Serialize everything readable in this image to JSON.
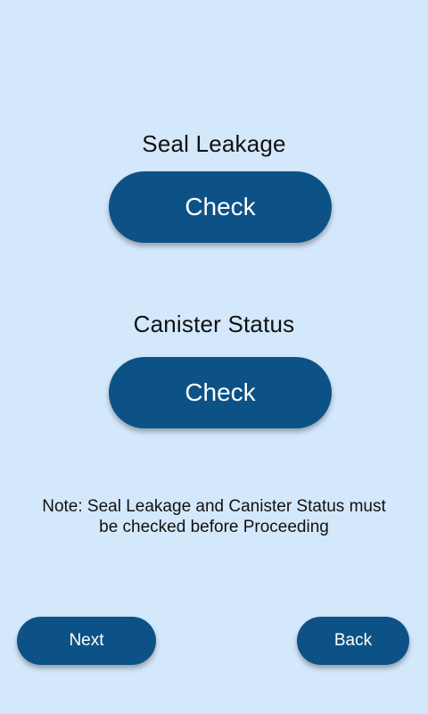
{
  "seal_leakage": {
    "title": "Seal Leakage",
    "button_label": "Check"
  },
  "canister_status": {
    "title": "Canister Status",
    "button_label": "Check"
  },
  "note": {
    "line1": "Note: Seal Leakage and Canister Status must",
    "line2": "be checked before Proceeding"
  },
  "navigation": {
    "next_label": "Next",
    "back_label": "Back"
  },
  "colors": {
    "background": "#d4e8fc",
    "button": "#0d5286",
    "button_text": "#ffffff",
    "text": "#111111"
  }
}
